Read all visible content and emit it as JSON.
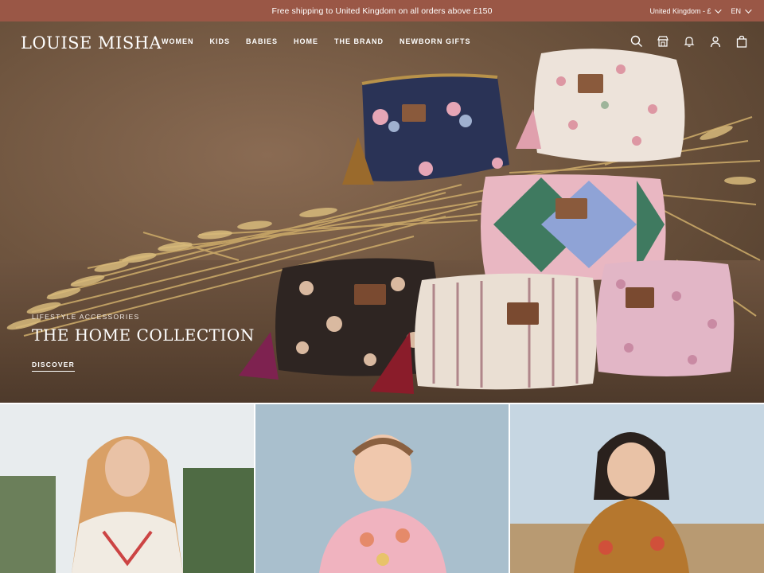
{
  "announcement": {
    "text": "Free shipping to United Kingdom on all orders above £150"
  },
  "locale": {
    "country": "United Kingdom - £",
    "language": "EN"
  },
  "brand": {
    "logo_text": "LOUISE MISHA"
  },
  "nav": {
    "items": [
      {
        "label": "WOMEN"
      },
      {
        "label": "KIDS"
      },
      {
        "label": "BABIES"
      },
      {
        "label": "HOME"
      },
      {
        "label": "THE BRAND"
      },
      {
        "label": "NEWBORN GIFTS"
      }
    ]
  },
  "header_icons": [
    "search-icon",
    "store-icon",
    "bell-icon",
    "account-icon",
    "bag-icon"
  ],
  "hero": {
    "eyebrow": "LIFESTYLE ACCESSORIES",
    "title": "THE HOME COLLECTION",
    "cta": "DISCOVER"
  },
  "tiles": [
    {
      "subject": "women-tile"
    },
    {
      "subject": "babies-tile"
    },
    {
      "subject": "kids-tile"
    }
  ],
  "colors": {
    "announcement_bg": "#9a5746",
    "hero_bg": "#6f553f",
    "text_light": "#ffffff"
  }
}
